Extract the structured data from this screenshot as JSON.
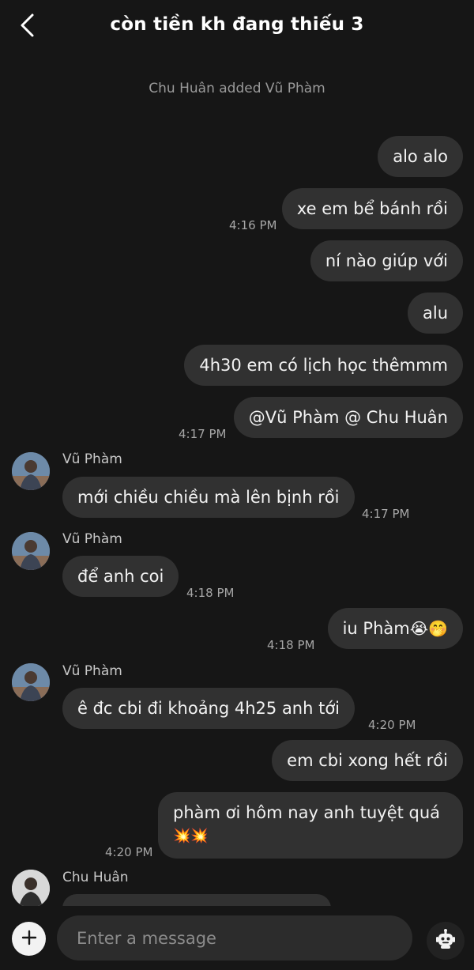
{
  "header": {
    "back_icon": "chevron-left-icon",
    "title": "còn tiền kh đang thiếu  3"
  },
  "system_note": "Chu Huân  added Vũ Phàm",
  "messages": {
    "m1": {
      "text": "alo alo"
    },
    "m2": {
      "text": "xe em bể bánh rồi",
      "time": "4:16 PM"
    },
    "m3": {
      "text": "ní nào giúp với"
    },
    "m4": {
      "text": "alu"
    },
    "m5": {
      "text": "4h30 em có lịch học thêmmm"
    },
    "m6": {
      "text": "@Vũ Phàm @ Chu Huân",
      "time": "4:17 PM"
    },
    "m7": {
      "sender": "Vũ Phàm",
      "text": "mới chiều chiều mà lên bịnh rồi",
      "time": "4:17 PM"
    },
    "m8": {
      "sender": "Vũ Phàm",
      "text": "để anh coi",
      "time": "4:18 PM"
    },
    "m9": {
      "text": "iu Phàm",
      "emoji": "😭🤭",
      "time": "4:18 PM"
    },
    "m10": {
      "sender": "Vũ Phàm",
      "text": "ê đc cbi đi khoảng 4h25 anh tới",
      "time": "4:20 PM"
    },
    "m11": {
      "text": "em cbi xong hết rồi"
    },
    "m12": {
      "text": "phàm ơi hôm nay anh tuyệt quá",
      "emoji": "💥💥",
      "time": "4:20 PM"
    },
    "m13": {
      "sender": "Chu Huân"
    }
  },
  "composer": {
    "add_icon": "plus-icon",
    "placeholder": "Enter a message",
    "bot_icon": "robot-icon"
  },
  "colors": {
    "background": "#161616",
    "bubble": "#313131",
    "input": "#2c2c2c"
  }
}
